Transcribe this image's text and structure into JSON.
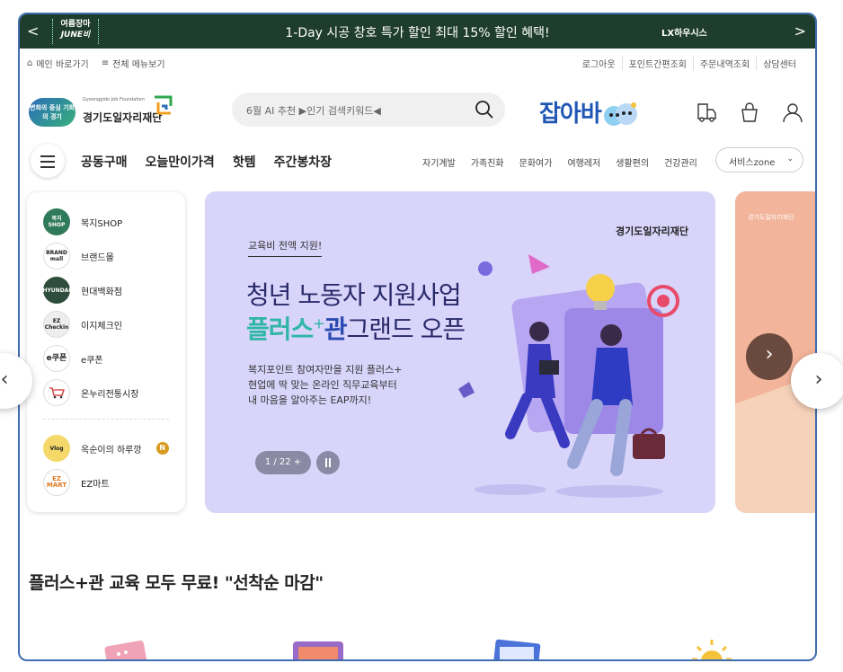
{
  "promo": {
    "badge_line1": "여름장마",
    "badge_line2": "JUNE비",
    "text": "1-Day 시공 창호 특가 할인   최대 15% 할인 혜택!",
    "brand": "LX하우시스",
    "prev": "<",
    "next": ">"
  },
  "util": {
    "home": "메인 바로가기",
    "menu": "전체 메뉴보기",
    "links": [
      "로그아웃",
      "포인트간편조회",
      "주문내역조회",
      "상담센터"
    ]
  },
  "header": {
    "badge": "변화의 중심 기회의 경기",
    "foundation_en": "Gyeonggido Job Foundation",
    "foundation_ko": "경기도일자리재단",
    "search_placeholder": "6월 AI 추천 ▶인기 검색키워드◀",
    "jobaba": "잡아바"
  },
  "nav": {
    "main": [
      "공동구매",
      "오늘만이가격",
      "핫템",
      "주간봉차장"
    ],
    "sub": [
      "자기계발",
      "가족친화",
      "문화여가",
      "여행레저",
      "생활편의",
      "건강관리"
    ],
    "zone": "서비스zone"
  },
  "sidebar": {
    "items": [
      {
        "icon": "복지 SHOP",
        "label": "복지SHOP"
      },
      {
        "icon": "BRAND mall",
        "label": "브랜드몰"
      },
      {
        "icon": "HYUNDAI",
        "label": "현대백화점"
      },
      {
        "icon": "EZ Checkin",
        "label": "이지체크인"
      },
      {
        "icon": "e쿠폰",
        "label": "e쿠폰"
      },
      {
        "icon": "",
        "label": "온누리전통시장"
      },
      {
        "icon": "Vlog",
        "label": "옥순이의 하루깡",
        "badge": "N"
      },
      {
        "icon": "EZ MART",
        "label": "EZ마트"
      }
    ]
  },
  "banner": {
    "eyebrow": "교육비 전액 지원!",
    "title1": "청년 노동자 지원사업",
    "title2_plus": "플러스",
    "title2_sup": "+",
    "title2_gwan": "관",
    "title2_rest": "그랜드 오픈",
    "desc": [
      "복지포인트 참여자만을 지원 플러스+",
      "현업에 딱 맞는 온라인 직무교육부터",
      "내 마음을 알아주는 EAP까지!"
    ],
    "brand": "경기도일자리재단",
    "pager": "1 / 22 +"
  },
  "section_title": "플러스+관 교육 모두 무료! \"선착순 마감\""
}
